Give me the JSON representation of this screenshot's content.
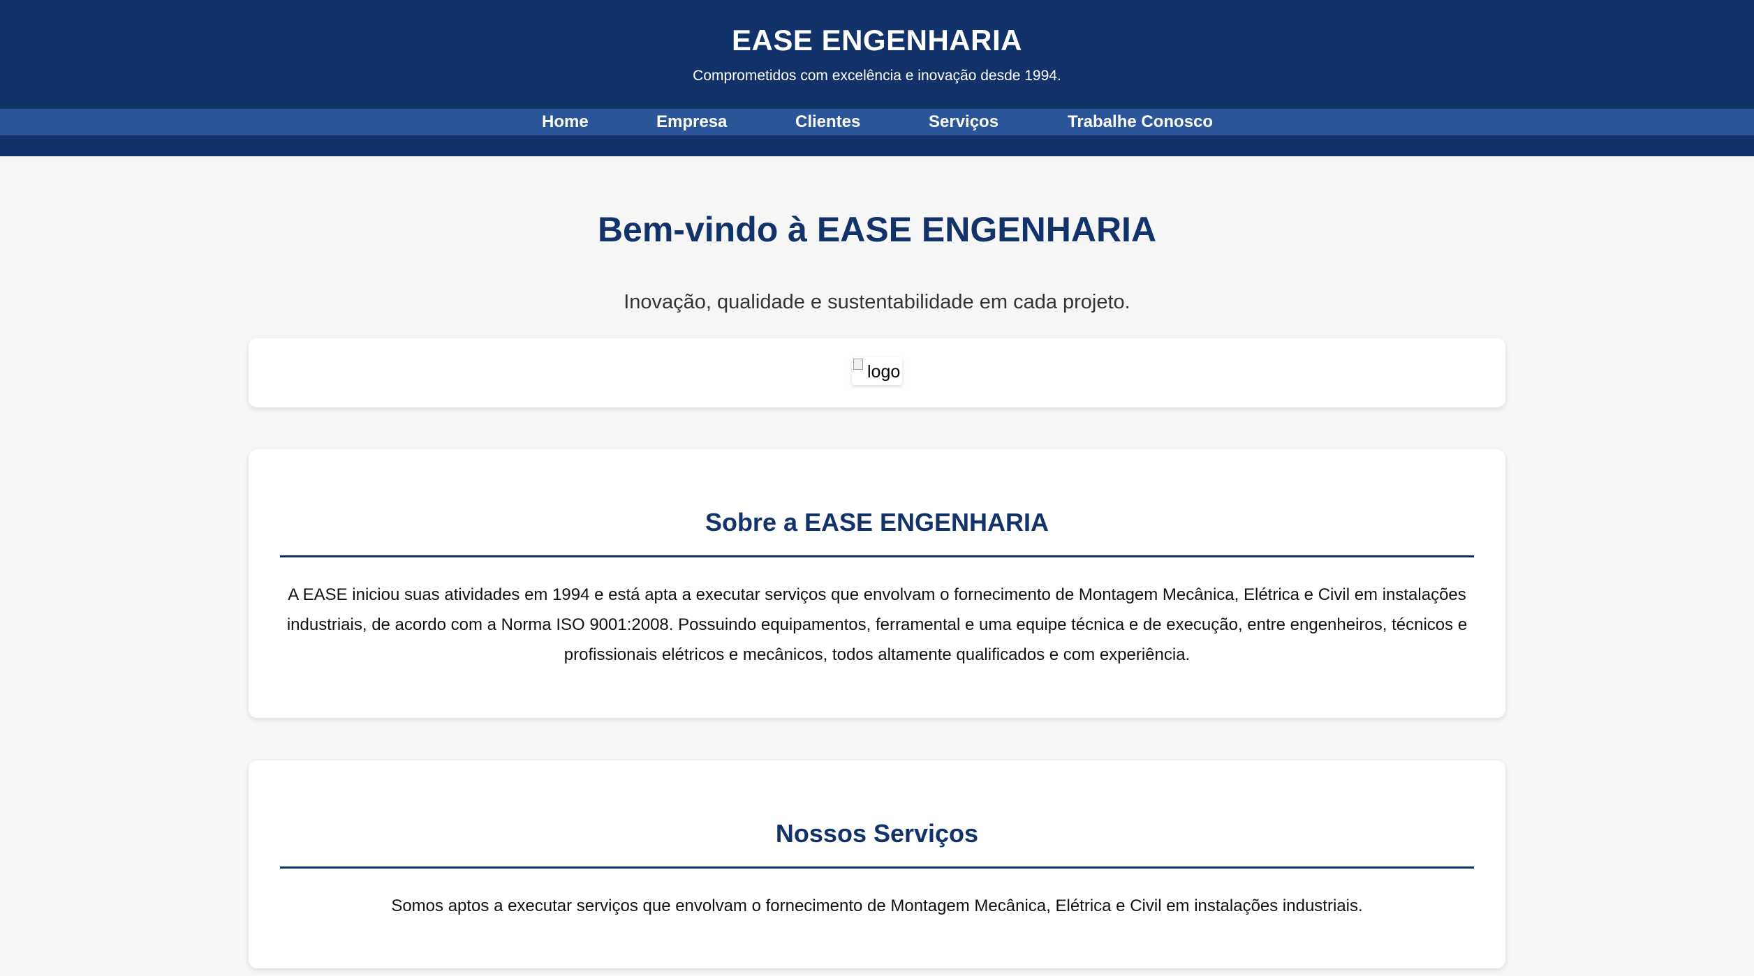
{
  "header": {
    "title": "EASE ENGENHARIA",
    "tagline": "Comprometidos com excelência e inovação desde 1994."
  },
  "nav": {
    "items": [
      "Home",
      "Empresa",
      "Clientes",
      "Serviços",
      "Trabalhe Conosco"
    ]
  },
  "hero": {
    "title": "Bem-vindo à EASE ENGENHARIA",
    "subtitle": "Inovação, qualidade e sustentabilidade em cada projeto.",
    "logo_alt": "logo"
  },
  "about": {
    "title": "Sobre a EASE ENGENHARIA",
    "text": "A EASE iniciou suas atividades em 1994 e está apta a executar serviços que envolvam o fornecimento de Montagem Mecânica, Elétrica e Civil em instalações industriais, de acordo com a Norma ISO 9001:2008. Possuindo equipamentos, ferramental e uma equipe técnica e de execução, entre engenheiros, técnicos e profissionais elétricos e mecânicos, todos altamente qualificados e com experiência."
  },
  "services": {
    "title": "Nossos Serviços",
    "text": "Somos aptos a executar serviços que envolvam o fornecimento de Montagem Mecânica, Elétrica e Civil em instalações industriais."
  },
  "colors": {
    "header_bg": "#12336a",
    "nav_bg": "#2a5598",
    "accent": "#12336a",
    "page_bg": "#f6f6f6"
  }
}
